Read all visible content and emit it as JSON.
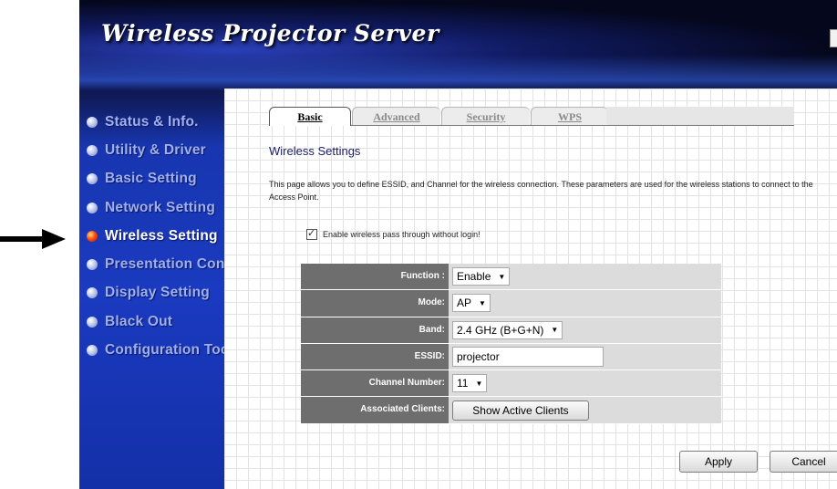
{
  "app": {
    "title": "Wireless Projector Server"
  },
  "sidebar": {
    "items": [
      {
        "label": "Status & Info.",
        "active": false
      },
      {
        "label": "Utility & Driver",
        "active": false
      },
      {
        "label": "Basic Setting",
        "active": false
      },
      {
        "label": "Network Setting",
        "active": false
      },
      {
        "label": "Wireless Setting",
        "active": true
      },
      {
        "label": "Presentation Control",
        "active": false
      },
      {
        "label": "Display Setting",
        "active": false
      },
      {
        "label": "Black Out",
        "active": false
      },
      {
        "label": "Configuration Tools",
        "active": false
      }
    ]
  },
  "tabs": [
    {
      "label": "Basic",
      "active": true
    },
    {
      "label": "Advanced",
      "active": false
    },
    {
      "label": "Security",
      "active": false
    },
    {
      "label": "WPS",
      "active": false
    }
  ],
  "main": {
    "section_title": "Wireless Settings",
    "description": "This page allows you to define ESSID, and Channel for the wireless connection. These parameters are used for the wireless stations to connect to the Access Point.",
    "passthrough_label": "Enable wireless pass through without login!",
    "passthrough_checked": true
  },
  "settings": {
    "function": {
      "label": "Function :",
      "value": "Enable"
    },
    "mode": {
      "label": "Mode:",
      "value": "AP"
    },
    "band": {
      "label": "Band:",
      "value": "2.4 GHz (B+G+N)"
    },
    "essid": {
      "label": "ESSID:",
      "value": "projector"
    },
    "channel": {
      "label": "Channel Number:",
      "value": "11"
    },
    "clients": {
      "label": "Associated Clients:",
      "button_label": "Show Active Clients"
    }
  },
  "actions": {
    "apply_label": "Apply",
    "cancel_label": "Cancel"
  },
  "colors": {
    "active_nav": "#ffffff",
    "inactive_nav": "#9fb0ec",
    "label_cell": "#6e6e6e",
    "value_cell": "#dcdcdc"
  }
}
